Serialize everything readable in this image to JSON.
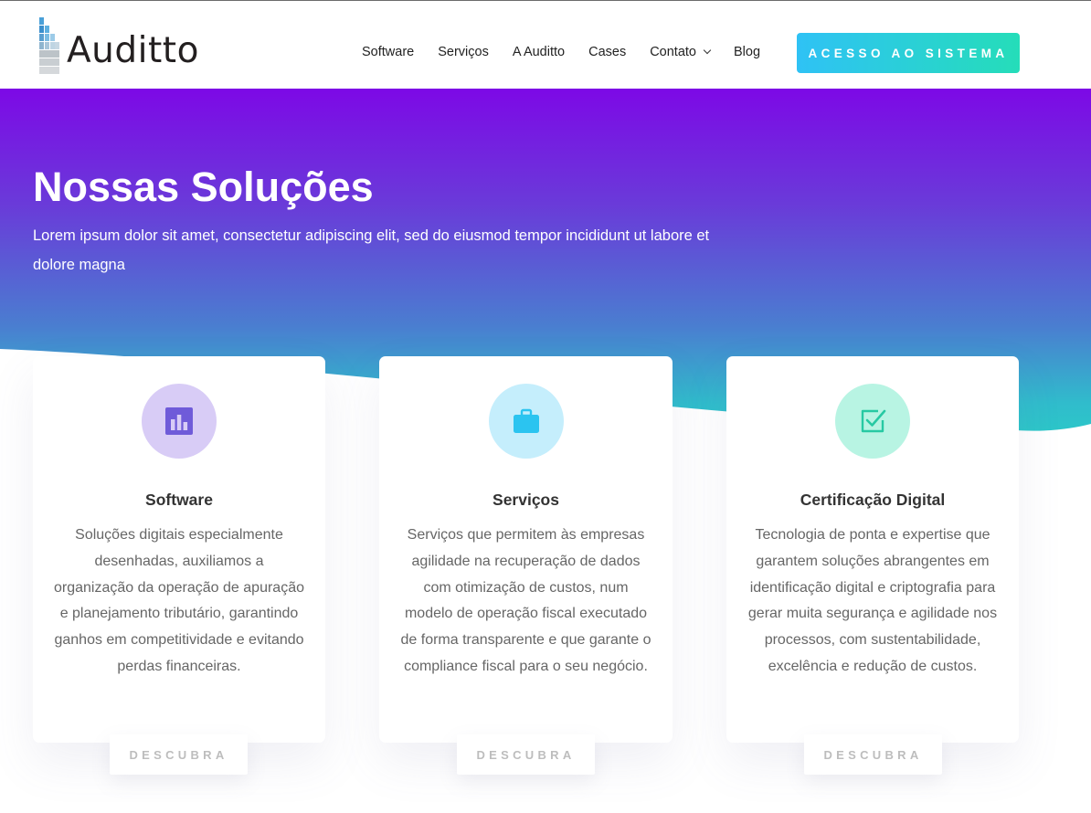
{
  "header": {
    "logo_text": "Auditto",
    "nav": [
      {
        "label": "Software"
      },
      {
        "label": "Serviços"
      },
      {
        "label": "A Auditto"
      },
      {
        "label": "Cases"
      },
      {
        "label": "Contato"
      },
      {
        "label": "Blog"
      }
    ],
    "cta_label": "ACESSO AO SISTEMA"
  },
  "hero": {
    "title": "Nossas Soluções",
    "subtitle": "Lorem ipsum dolor sit amet, consectetur adipiscing elit, sed do eiusmod tempor incididunt ut labore et dolore magna"
  },
  "cards": [
    {
      "icon": "bar-chart-icon",
      "title": "Software",
      "text": "Soluções digitais especialmente desenhadas, auxiliamos a organização da operação de apuração e planejamento tributário, garantindo ganhos em competitividade e evitando perdas financeiras.",
      "button": "DESCUBRA"
    },
    {
      "icon": "briefcase-icon",
      "title": "Serviços",
      "text": "Serviços que permitem às empresas agilidade na recuperação de dados com otimização de custos, num modelo de operação fiscal executado de forma transparente e que garante o compliance fiscal para o seu negócio.",
      "button": "DESCUBRA"
    },
    {
      "icon": "checkbox-icon",
      "title": "Certificação Digital",
      "text": "Tecnologia de ponta e expertise que garantem soluções abrangentes em identificação digital e criptografia para gerar muita segurança e agilidade nos processos, com sustentabilidade, excelência e redução de custos.",
      "button": "DESCUBRA"
    }
  ],
  "colors": {
    "hero_top": "#7d09e6",
    "hero_bottom": "#27d5c4",
    "cta_start": "#2fc2f5",
    "cta_end": "#25ddb9",
    "icon_purple": "#6f5bd9",
    "icon_blue": "#2bc4f0",
    "icon_teal": "#27c9a3"
  }
}
